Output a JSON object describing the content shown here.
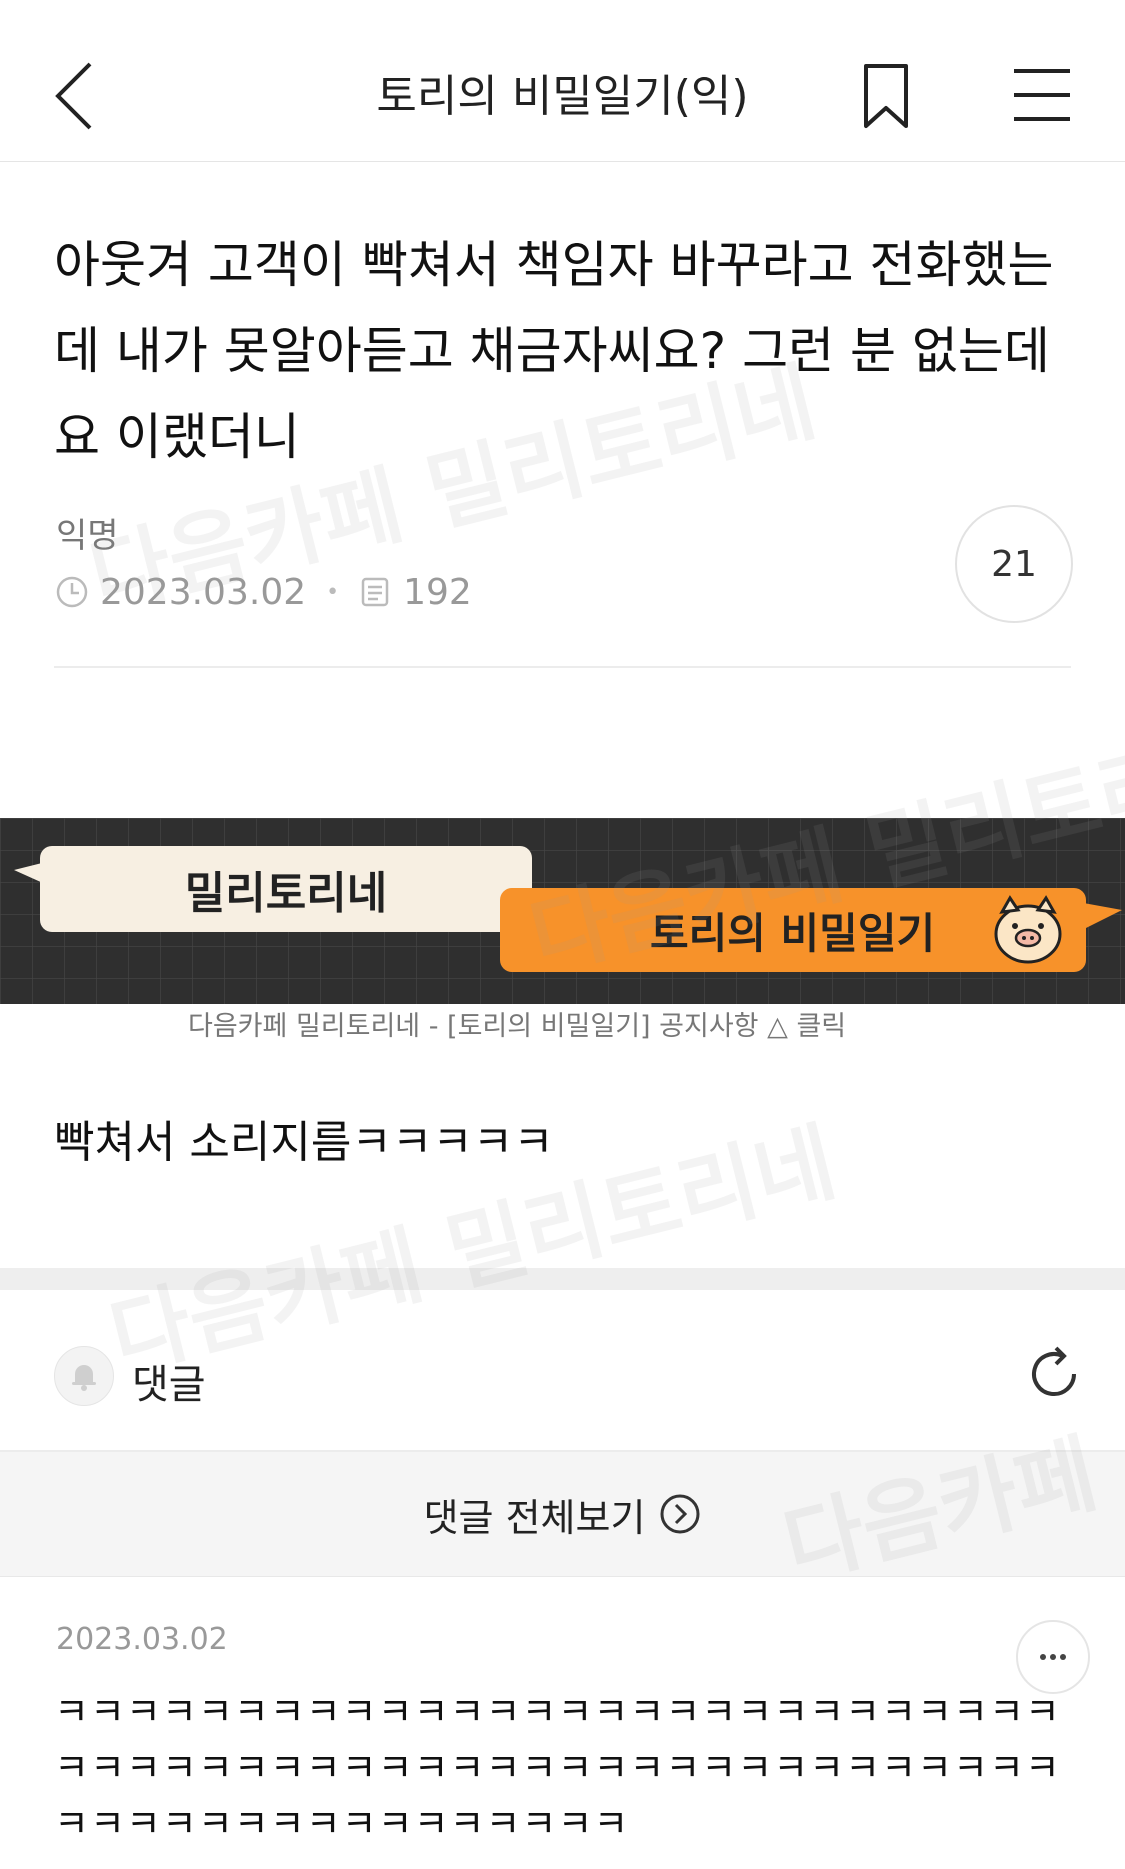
{
  "header": {
    "title": "토리의 비밀일기(익)"
  },
  "post": {
    "title": "아웃겨 고객이 빡쳐서 책임자 바꾸라고 전화했는데 내가 못알아듣고 채금자씨요? 그런 분 없는데요 이랬더니",
    "author": "익명",
    "date": "2023.03.02",
    "views": "192",
    "comment_count": "21",
    "body": "빡쳐서 소리지름ㅋㅋㅋㅋㅋ"
  },
  "banner": {
    "left_label": "밀리토리네",
    "right_label": "토리의 비밀일기",
    "caption": "다음카페 밀리토리네 - [토리의 비밀일기] 공지사항 △ 클릭"
  },
  "comments": {
    "label": "댓글",
    "view_all": "댓글 전체보기",
    "items": [
      {
        "date": "2023.03.02",
        "text": "ㅋㅋㅋㅋㅋㅋㅋㅋㅋㅋㅋㅋㅋㅋㅋㅋㅋㅋㅋㅋㅋㅋㅋㅋㅋㅋㅋㅋㅋㅋㅋㅋㅋㅋㅋㅋㅋㅋㅋㅋㅋㅋㅋㅋㅋㅋㅋㅋㅋㅋㅋㅋㅋㅋㅋㅋㅋㅋㅋㅋㅋㅋㅋㅋㅋㅋㅋㅋㅋㅋㅋㅋ"
      }
    ]
  },
  "watermarks": [
    "다음카페 밀리토리네",
    "다음카페 밀리토리네",
    "다음카페 밀리토리네",
    "다음카페"
  ],
  "colors": {
    "accent_orange": "#f7922a",
    "banner_dark": "#2f2f2f",
    "banner_cream": "#f7efe2"
  }
}
